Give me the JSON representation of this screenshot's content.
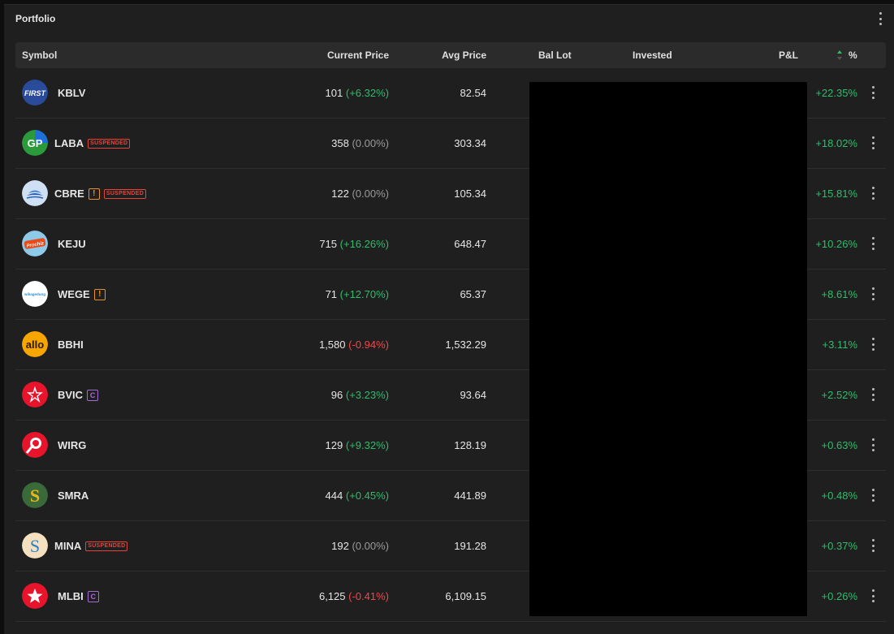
{
  "panel": {
    "title": "Portfolio"
  },
  "columns": {
    "symbol": "Symbol",
    "current_price": "Current Price",
    "avg_price": "Avg Price",
    "bal_lot": "Bal Lot",
    "invested": "Invested",
    "pnl": "P&L",
    "pct": "%"
  },
  "colors": {
    "positive": "#2ebd6b",
    "negative": "#f0484a",
    "neutral": "#9a9a9a",
    "suspended": "#e0463c",
    "warning": "#e8912c",
    "c_badge": "#a46bd6"
  },
  "rows": [
    {
      "symbol": "KBLV",
      "logo": "first-logo-icon",
      "logo_text": "FIRST",
      "badges": [],
      "price": "101",
      "change": "(+6.32%)",
      "trend": "pos",
      "avg": "82.54",
      "pct": "+22.35%"
    },
    {
      "symbol": "LABA",
      "logo": "gp-logo-icon",
      "logo_text": "GP",
      "badges": [
        "SUSPENDED"
      ],
      "price": "358",
      "change": "(0.00%)",
      "trend": "neu",
      "avg": "303.34",
      "pct": "+18.02%"
    },
    {
      "symbol": "CBRE",
      "logo": "ship-logo-icon",
      "badges": [
        "!",
        "SUSPENDED"
      ],
      "price": "122",
      "change": "(0.00%)",
      "trend": "neu",
      "avg": "105.34",
      "pct": "+15.81%"
    },
    {
      "symbol": "KEJU",
      "logo": "prochiz-logo-icon",
      "logo_text": "Prochiz",
      "badges": [],
      "price": "715",
      "change": "(+16.26%)",
      "trend": "pos",
      "avg": "648.47",
      "pct": "+10.26%"
    },
    {
      "symbol": "WEGE",
      "logo": "wika-logo-icon",
      "logo_text": "wikagedung",
      "badges": [
        "!"
      ],
      "price": "71",
      "change": "(+12.70%)",
      "trend": "pos",
      "avg": "65.37",
      "pct": "+8.61%"
    },
    {
      "symbol": "BBHI",
      "logo": "allo-logo-icon",
      "logo_text": "allo",
      "badges": [],
      "price": "1,580",
      "change": "(-0.94%)",
      "trend": "neg",
      "avg": "1,532.29",
      "pct": "+3.11%"
    },
    {
      "symbol": "BVIC",
      "logo": "victoria-logo-icon",
      "badges": [
        "C"
      ],
      "price": "96",
      "change": "(+3.23%)",
      "trend": "pos",
      "avg": "93.64",
      "pct": "+2.52%"
    },
    {
      "symbol": "WIRG",
      "logo": "wirg-logo-icon",
      "badges": [],
      "price": "129",
      "change": "(+9.32%)",
      "trend": "pos",
      "avg": "128.19",
      "pct": "+0.63%"
    },
    {
      "symbol": "SMRA",
      "logo": "summarecon-logo-icon",
      "logo_text": "S",
      "badges": [],
      "price": "444",
      "change": "(+0.45%)",
      "trend": "pos",
      "avg": "441.89",
      "pct": "+0.48%"
    },
    {
      "symbol": "MINA",
      "logo": "mina-logo-icon",
      "logo_text": "S",
      "badges": [
        "SUSPENDED"
      ],
      "price": "192",
      "change": "(0.00%)",
      "trend": "neu",
      "avg": "191.28",
      "pct": "+0.37%"
    },
    {
      "symbol": "MLBI",
      "logo": "bintang-logo-icon",
      "badges": [
        "C"
      ],
      "price": "6,125",
      "change": "(-0.41%)",
      "trend": "neg",
      "avg": "6,109.15",
      "pct": "+0.26%"
    }
  ]
}
